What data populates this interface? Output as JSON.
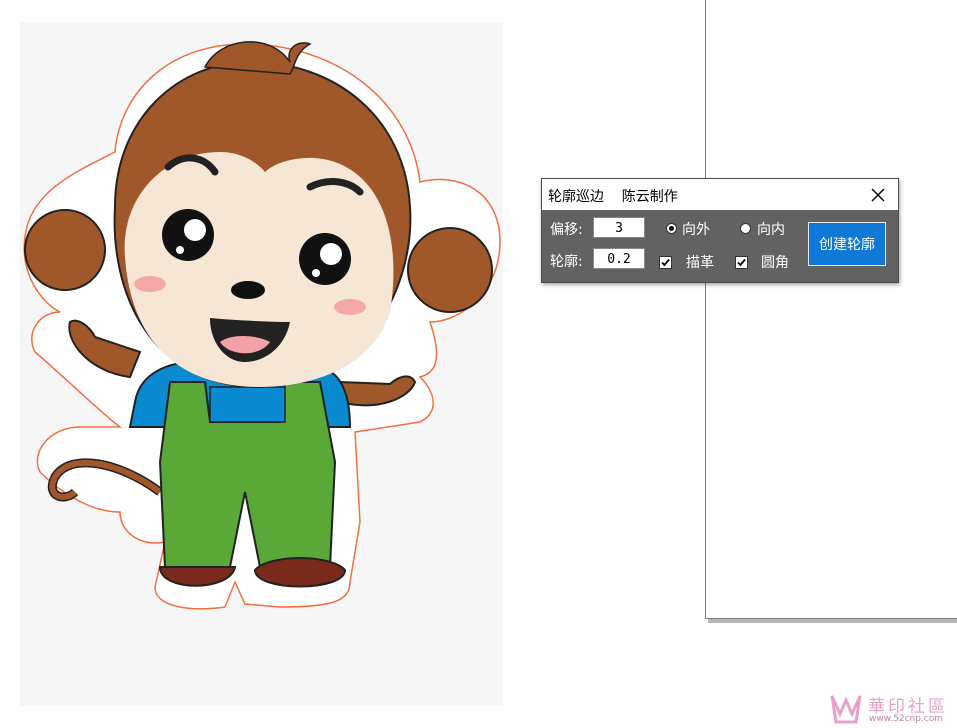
{
  "dialog": {
    "title": "轮廓巡边    陈云制作",
    "offset_label": "偏移:",
    "offset_value": "3",
    "outline_label": "轮廓:",
    "outline_value": "0.2",
    "radio_outward": "向外",
    "radio_inward": "向内",
    "radio_selected": "outward",
    "check_stroke": "描革",
    "check_stroke_checked": true,
    "check_round": "圆角",
    "check_round_checked": true,
    "create_button": "创建轮廓",
    "accent_color": "#1079d8"
  },
  "watermark": {
    "text": "華印社區",
    "url": "www.52cnp.com"
  },
  "icons": [
    "close-icon",
    "check-icon",
    "monkey-artwork",
    "watermark-logo-icon"
  ]
}
